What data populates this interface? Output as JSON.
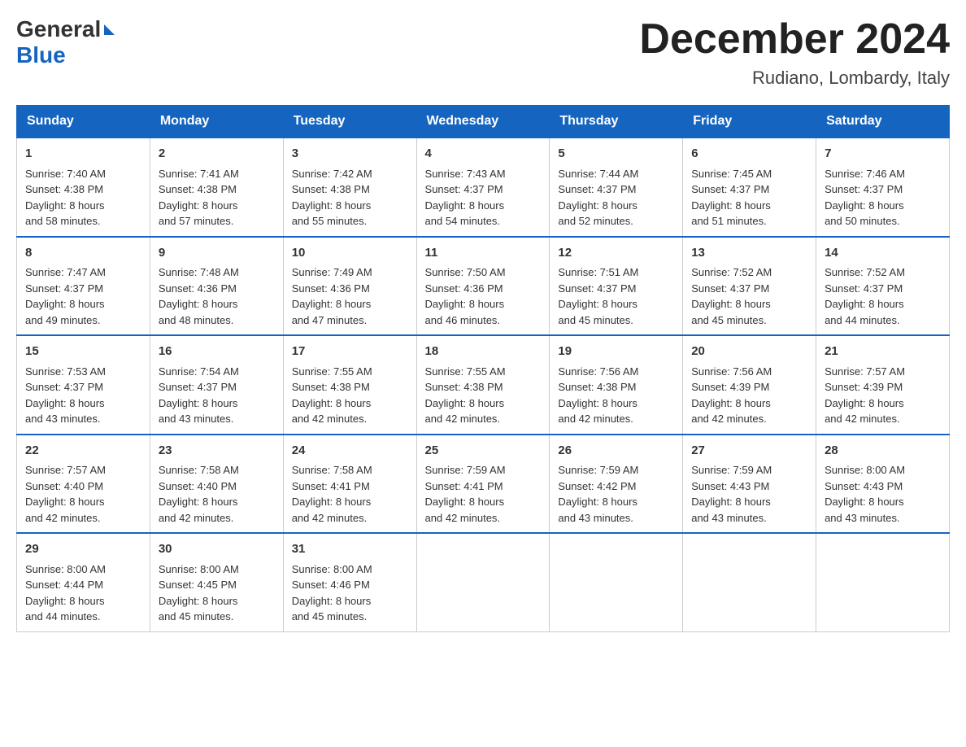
{
  "header": {
    "logo_general": "General",
    "logo_blue": "Blue",
    "month_title": "December 2024",
    "location": "Rudiano, Lombardy, Italy"
  },
  "weekdays": [
    "Sunday",
    "Monday",
    "Tuesday",
    "Wednesday",
    "Thursday",
    "Friday",
    "Saturday"
  ],
  "weeks": [
    [
      {
        "day": "1",
        "sunrise": "7:40 AM",
        "sunset": "4:38 PM",
        "daylight": "8 hours and 58 minutes."
      },
      {
        "day": "2",
        "sunrise": "7:41 AM",
        "sunset": "4:38 PM",
        "daylight": "8 hours and 57 minutes."
      },
      {
        "day": "3",
        "sunrise": "7:42 AM",
        "sunset": "4:38 PM",
        "daylight": "8 hours and 55 minutes."
      },
      {
        "day": "4",
        "sunrise": "7:43 AM",
        "sunset": "4:37 PM",
        "daylight": "8 hours and 54 minutes."
      },
      {
        "day": "5",
        "sunrise": "7:44 AM",
        "sunset": "4:37 PM",
        "daylight": "8 hours and 52 minutes."
      },
      {
        "day": "6",
        "sunrise": "7:45 AM",
        "sunset": "4:37 PM",
        "daylight": "8 hours and 51 minutes."
      },
      {
        "day": "7",
        "sunrise": "7:46 AM",
        "sunset": "4:37 PM",
        "daylight": "8 hours and 50 minutes."
      }
    ],
    [
      {
        "day": "8",
        "sunrise": "7:47 AM",
        "sunset": "4:37 PM",
        "daylight": "8 hours and 49 minutes."
      },
      {
        "day": "9",
        "sunrise": "7:48 AM",
        "sunset": "4:36 PM",
        "daylight": "8 hours and 48 minutes."
      },
      {
        "day": "10",
        "sunrise": "7:49 AM",
        "sunset": "4:36 PM",
        "daylight": "8 hours and 47 minutes."
      },
      {
        "day": "11",
        "sunrise": "7:50 AM",
        "sunset": "4:36 PM",
        "daylight": "8 hours and 46 minutes."
      },
      {
        "day": "12",
        "sunrise": "7:51 AM",
        "sunset": "4:37 PM",
        "daylight": "8 hours and 45 minutes."
      },
      {
        "day": "13",
        "sunrise": "7:52 AM",
        "sunset": "4:37 PM",
        "daylight": "8 hours and 45 minutes."
      },
      {
        "day": "14",
        "sunrise": "7:52 AM",
        "sunset": "4:37 PM",
        "daylight": "8 hours and 44 minutes."
      }
    ],
    [
      {
        "day": "15",
        "sunrise": "7:53 AM",
        "sunset": "4:37 PM",
        "daylight": "8 hours and 43 minutes."
      },
      {
        "day": "16",
        "sunrise": "7:54 AM",
        "sunset": "4:37 PM",
        "daylight": "8 hours and 43 minutes."
      },
      {
        "day": "17",
        "sunrise": "7:55 AM",
        "sunset": "4:38 PM",
        "daylight": "8 hours and 42 minutes."
      },
      {
        "day": "18",
        "sunrise": "7:55 AM",
        "sunset": "4:38 PM",
        "daylight": "8 hours and 42 minutes."
      },
      {
        "day": "19",
        "sunrise": "7:56 AM",
        "sunset": "4:38 PM",
        "daylight": "8 hours and 42 minutes."
      },
      {
        "day": "20",
        "sunrise": "7:56 AM",
        "sunset": "4:39 PM",
        "daylight": "8 hours and 42 minutes."
      },
      {
        "day": "21",
        "sunrise": "7:57 AM",
        "sunset": "4:39 PM",
        "daylight": "8 hours and 42 minutes."
      }
    ],
    [
      {
        "day": "22",
        "sunrise": "7:57 AM",
        "sunset": "4:40 PM",
        "daylight": "8 hours and 42 minutes."
      },
      {
        "day": "23",
        "sunrise": "7:58 AM",
        "sunset": "4:40 PM",
        "daylight": "8 hours and 42 minutes."
      },
      {
        "day": "24",
        "sunrise": "7:58 AM",
        "sunset": "4:41 PM",
        "daylight": "8 hours and 42 minutes."
      },
      {
        "day": "25",
        "sunrise": "7:59 AM",
        "sunset": "4:41 PM",
        "daylight": "8 hours and 42 minutes."
      },
      {
        "day": "26",
        "sunrise": "7:59 AM",
        "sunset": "4:42 PM",
        "daylight": "8 hours and 43 minutes."
      },
      {
        "day": "27",
        "sunrise": "7:59 AM",
        "sunset": "4:43 PM",
        "daylight": "8 hours and 43 minutes."
      },
      {
        "day": "28",
        "sunrise": "8:00 AM",
        "sunset": "4:43 PM",
        "daylight": "8 hours and 43 minutes."
      }
    ],
    [
      {
        "day": "29",
        "sunrise": "8:00 AM",
        "sunset": "4:44 PM",
        "daylight": "8 hours and 44 minutes."
      },
      {
        "day": "30",
        "sunrise": "8:00 AM",
        "sunset": "4:45 PM",
        "daylight": "8 hours and 45 minutes."
      },
      {
        "day": "31",
        "sunrise": "8:00 AM",
        "sunset": "4:46 PM",
        "daylight": "8 hours and 45 minutes."
      },
      null,
      null,
      null,
      null
    ]
  ],
  "labels": {
    "sunrise": "Sunrise:",
    "sunset": "Sunset:",
    "daylight": "Daylight:"
  },
  "accent_color": "#1565c0"
}
